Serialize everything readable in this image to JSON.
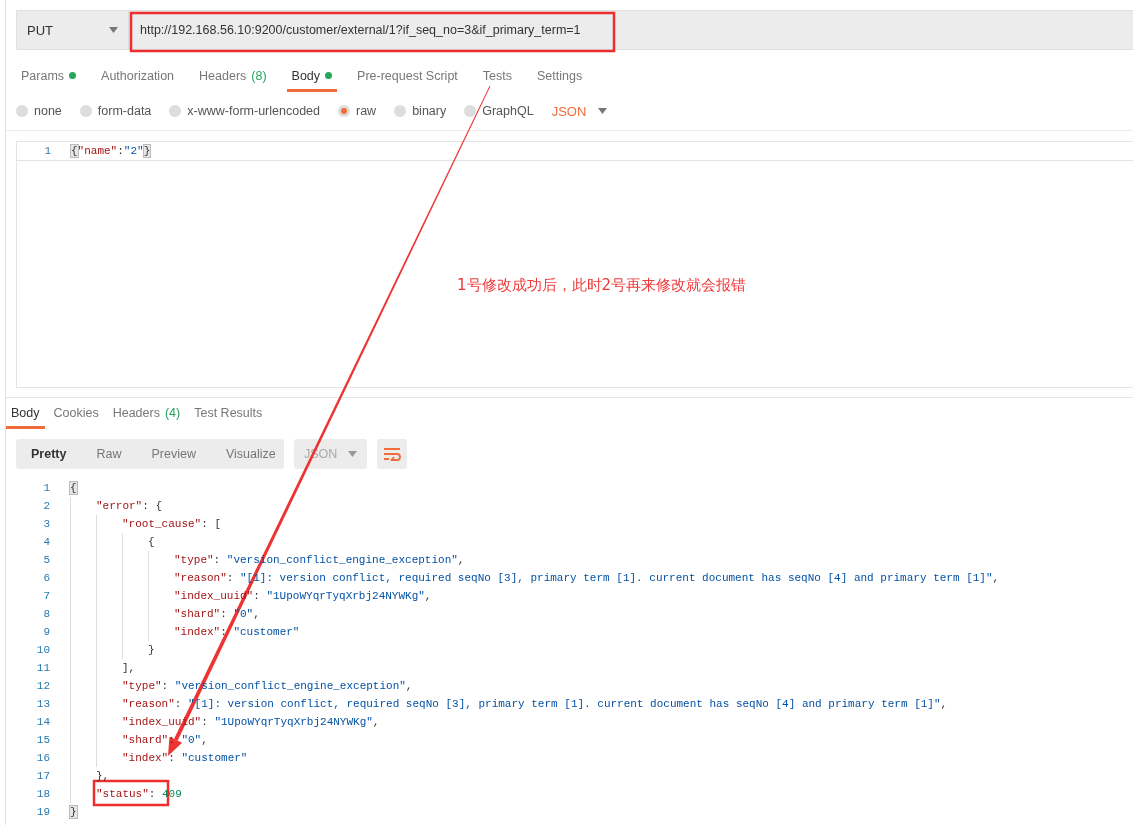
{
  "request": {
    "method": "PUT",
    "url": "http://192.168.56.10:9200/customer/external/1?if_seq_no=3&if_primary_term=1"
  },
  "request_tabs": [
    {
      "label": "Params",
      "dot": true,
      "selected": false
    },
    {
      "label": "Authorization",
      "dot": false,
      "selected": false
    },
    {
      "label": "Headers",
      "count": "(8)",
      "dot": false,
      "selected": false
    },
    {
      "label": "Body",
      "dot": true,
      "selected": true
    },
    {
      "label": "Pre-request Script",
      "dot": false,
      "selected": false
    },
    {
      "label": "Tests",
      "dot": false,
      "selected": false
    },
    {
      "label": "Settings",
      "dot": false,
      "selected": false
    }
  ],
  "body_types": [
    {
      "label": "none",
      "selected": false
    },
    {
      "label": "form-data",
      "selected": false
    },
    {
      "label": "x-www-form-urlencoded",
      "selected": false
    },
    {
      "label": "raw",
      "selected": true
    },
    {
      "label": "binary",
      "selected": false
    },
    {
      "label": "GraphQL",
      "selected": false
    }
  ],
  "body_format": "JSON",
  "request_body": [
    {
      "number": "1",
      "tokens": [
        {
          "kind": "punct",
          "text": "{",
          "highlight": true
        },
        {
          "kind": "key",
          "text": "\"name\""
        },
        {
          "kind": "punct",
          "text": ":"
        },
        {
          "kind": "string",
          "text": "\"2\""
        },
        {
          "kind": "punct",
          "text": "}",
          "highlight": true
        }
      ]
    }
  ],
  "annotation": "1号修改成功后，此时2号再来修改就会报错",
  "response_tabs": [
    {
      "label": "Body",
      "selected": true
    },
    {
      "label": "Cookies",
      "selected": false
    },
    {
      "label": "Headers",
      "count": "(4)",
      "selected": false
    },
    {
      "label": "Test Results",
      "selected": false
    }
  ],
  "view_modes": [
    {
      "label": "Pretty",
      "selected": true
    },
    {
      "label": "Raw",
      "selected": false
    },
    {
      "label": "Preview",
      "selected": false
    },
    {
      "label": "Visualize",
      "selected": false
    }
  ],
  "response_format": "JSON",
  "response_body": [
    {
      "number": "1",
      "tokens": [
        {
          "kind": "punct",
          "text": "{",
          "highlight": true
        }
      ],
      "children": [
        {
          "number": "2",
          "tokens": [
            {
              "kind": "key",
              "text": "\"error\""
            },
            {
              "kind": "punct",
              "text": ": {"
            }
          ],
          "children": [
            {
              "number": "3",
              "tokens": [
                {
                  "kind": "key",
                  "text": "\"root_cause\""
                },
                {
                  "kind": "punct",
                  "text": ": ["
                }
              ],
              "children": [
                {
                  "number": "4",
                  "tokens": [
                    {
                      "kind": "punct",
                      "text": "{"
                    }
                  ],
                  "children": [
                    {
                      "number": "5",
                      "tokens": [
                        {
                          "kind": "key",
                          "text": "\"type\""
                        },
                        {
                          "kind": "punct",
                          "text": ": "
                        },
                        {
                          "kind": "string",
                          "text": "\"version_conflict_engine_exception\""
                        },
                        {
                          "kind": "punct",
                          "text": ","
                        }
                      ]
                    },
                    {
                      "number": "6",
                      "tokens": [
                        {
                          "kind": "key",
                          "text": "\"reason\""
                        },
                        {
                          "kind": "punct",
                          "text": ": "
                        },
                        {
                          "kind": "string",
                          "text": "\"[1]: version conflict, required seqNo [3], primary term [1]. current document has seqNo [4] and primary term [1]\""
                        },
                        {
                          "kind": "punct",
                          "text": ","
                        }
                      ]
                    },
                    {
                      "number": "7",
                      "tokens": [
                        {
                          "kind": "key",
                          "text": "\"index_uuid\""
                        },
                        {
                          "kind": "punct",
                          "text": ": "
                        },
                        {
                          "kind": "string",
                          "text": "\"1UpoWYqrTyqXrbj24NYWKg\""
                        },
                        {
                          "kind": "punct",
                          "text": ","
                        }
                      ]
                    },
                    {
                      "number": "8",
                      "tokens": [
                        {
                          "kind": "key",
                          "text": "\"shard\""
                        },
                        {
                          "kind": "punct",
                          "text": ": "
                        },
                        {
                          "kind": "string",
                          "text": "\"0\""
                        },
                        {
                          "kind": "punct",
                          "text": ","
                        }
                      ]
                    },
                    {
                      "number": "9",
                      "tokens": [
                        {
                          "kind": "key",
                          "text": "\"index\""
                        },
                        {
                          "kind": "punct",
                          "text": ": "
                        },
                        {
                          "kind": "string",
                          "text": "\"customer\""
                        }
                      ]
                    }
                  ]
                },
                {
                  "number": "10",
                  "tokens": [
                    {
                      "kind": "punct",
                      "text": "}"
                    }
                  ]
                }
              ]
            },
            {
              "number": "11",
              "tokens": [
                {
                  "kind": "punct",
                  "text": "],"
                }
              ]
            },
            {
              "number": "12",
              "tokens": [
                {
                  "kind": "key",
                  "text": "\"type\""
                },
                {
                  "kind": "punct",
                  "text": ": "
                },
                {
                  "kind": "string",
                  "text": "\"version_conflict_engine_exception\""
                },
                {
                  "kind": "punct",
                  "text": ","
                }
              ]
            },
            {
              "number": "13",
              "tokens": [
                {
                  "kind": "key",
                  "text": "\"reason\""
                },
                {
                  "kind": "punct",
                  "text": ": "
                },
                {
                  "kind": "string",
                  "text": "\"[1]: version conflict, required seqNo [3], primary term [1]. current document has seqNo [4] and primary term [1]\""
                },
                {
                  "kind": "punct",
                  "text": ","
                }
              ]
            },
            {
              "number": "14",
              "tokens": [
                {
                  "kind": "key",
                  "text": "\"index_uuid\""
                },
                {
                  "kind": "punct",
                  "text": ": "
                },
                {
                  "kind": "string",
                  "text": "\"1UpoWYqrTyqXrbj24NYWKg\""
                },
                {
                  "kind": "punct",
                  "text": ","
                }
              ]
            },
            {
              "number": "15",
              "tokens": [
                {
                  "kind": "key",
                  "text": "\"shard\""
                },
                {
                  "kind": "punct",
                  "text": ": "
                },
                {
                  "kind": "string",
                  "text": "\"0\""
                },
                {
                  "kind": "punct",
                  "text": ","
                }
              ]
            },
            {
              "number": "16",
              "tokens": [
                {
                  "kind": "key",
                  "text": "\"index\""
                },
                {
                  "kind": "punct",
                  "text": ": "
                },
                {
                  "kind": "string",
                  "text": "\"customer\""
                }
              ]
            }
          ]
        },
        {
          "number": "17",
          "tokens": [
            {
              "kind": "punct",
              "text": "},"
            }
          ]
        },
        {
          "number": "18",
          "tokens": [
            {
              "kind": "key",
              "text": "\"status\""
            },
            {
              "kind": "punct",
              "text": ": "
            },
            {
              "kind": "number",
              "text": "409"
            }
          ]
        }
      ]
    },
    {
      "number": "19",
      "tokens": [
        {
          "kind": "punct",
          "text": "}",
          "highlight": true
        }
      ]
    }
  ]
}
